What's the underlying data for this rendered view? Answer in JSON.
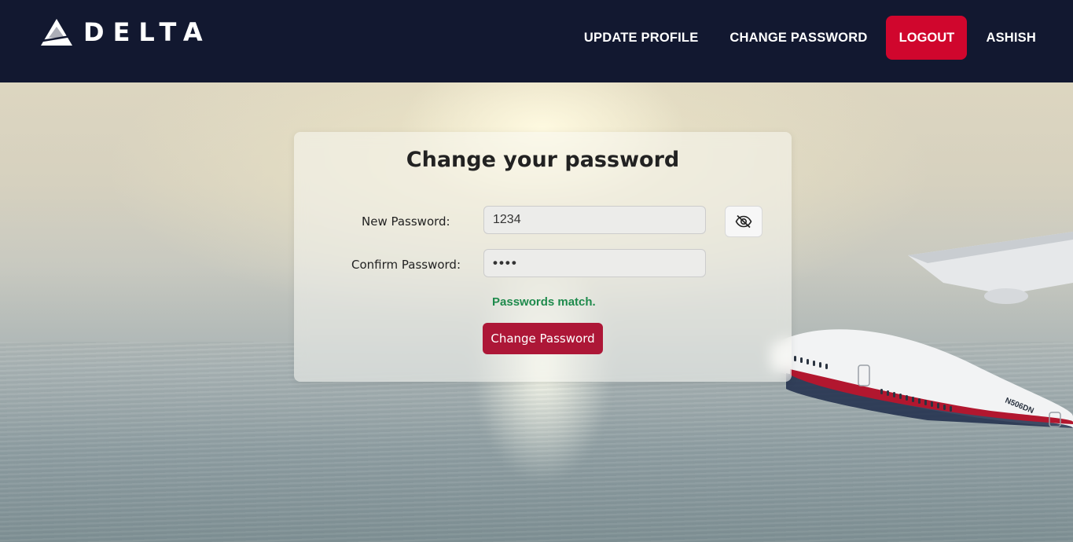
{
  "header": {
    "brand": "DELTA",
    "nav": {
      "update_profile": "UPDATE PROFILE",
      "change_password": "CHANGE PASSWORD",
      "logout": "LOGOUT",
      "user": "ASHISH"
    }
  },
  "form": {
    "title": "Change your password",
    "new_password_label": "New Password:",
    "new_password_value": "1234",
    "confirm_password_label": "Confirm Password:",
    "confirm_password_value": "••••",
    "toggle_icon": "eye-off-icon",
    "match_message": "Passwords match.",
    "submit_label": "Change Password"
  },
  "background": {
    "aircraft_registration": "N506DN"
  },
  "colors": {
    "navbar": "#121830",
    "logout": "#d0062d",
    "submit": "#ad1737",
    "success": "#1e8a4c"
  }
}
